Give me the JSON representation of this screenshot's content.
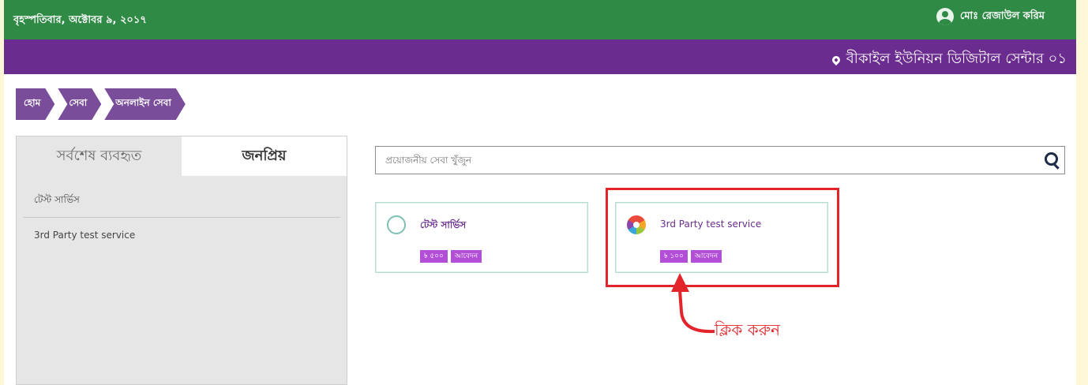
{
  "topbar": {
    "date": "বৃহস্পতিবার, অক্টোবর ৯, ২০১৭",
    "user_name": "মোঃ রেজাউল করিম"
  },
  "center_bar": {
    "center_name": "বীকাইল ইউনিয়ন ডিজিটাল সেন্টার ০১"
  },
  "breadcrumb": [
    "হোম",
    "সেবা",
    "অনলাইন সেবা"
  ],
  "left_panel": {
    "tabs": [
      {
        "label": "সর্বশেষ ব্যবহৃত",
        "active": true
      },
      {
        "label": "জনপ্রিয়",
        "active": false
      }
    ],
    "items": [
      "টেস্ট সার্ভিস",
      "3rd Party test service"
    ]
  },
  "search": {
    "placeholder": "প্রয়োজনীয় সেবা খুঁজুন"
  },
  "cards": [
    {
      "title": "টেস্ট সার্ভিস",
      "badges": [
        "৳ ৫০০",
        "আবেদন"
      ],
      "icon": "service-logo-icon"
    },
    {
      "title": "3rd Party test service",
      "badges": [
        "৳ ১০০",
        "আবেদন"
      ],
      "icon": "colorful-logo-icon"
    }
  ],
  "annotation": {
    "text": "ক্লিক করুন",
    "color": "#e3242b"
  },
  "colors": {
    "topbar": "#2f8a45",
    "center_bar": "#6b2c8f",
    "breadcrumb": "#7a4d9a",
    "badge": "#b24fd6"
  }
}
